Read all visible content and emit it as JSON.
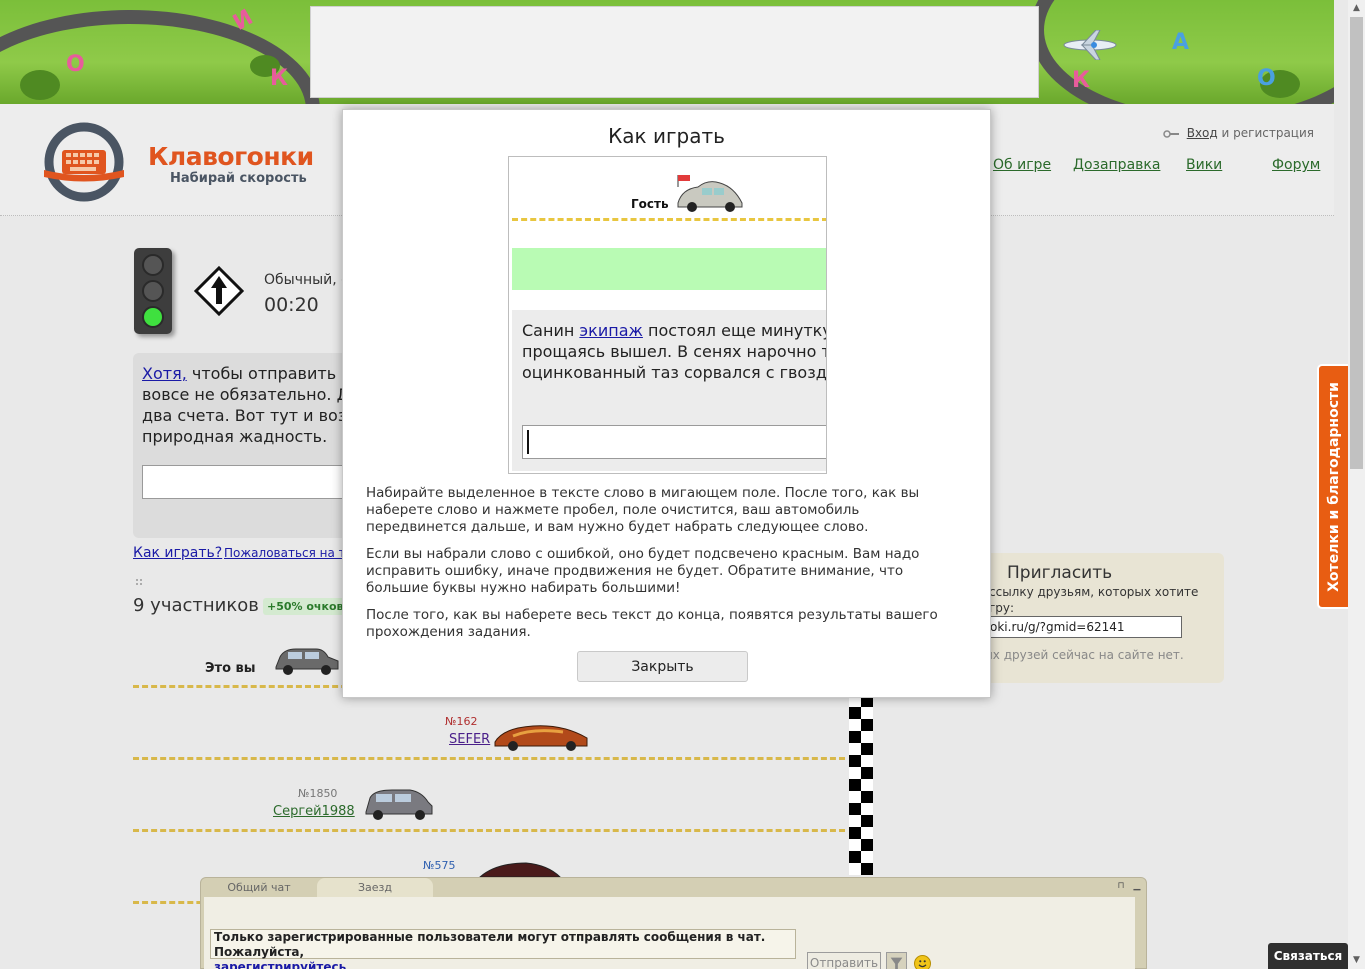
{
  "header": {
    "logo_title": "Клавогонки",
    "logo_subtitle": "Набирай скорость",
    "login_label": "Вход",
    "login_suffix": "и регистрация",
    "nav": [
      "Об игре",
      "Дозаправка",
      "Вики",
      "Форум"
    ],
    "banner_letters": [
      "О",
      "К",
      "И",
      "К",
      "А",
      "О"
    ]
  },
  "game": {
    "type_text": "Обычный, от",
    "timer": "00:20",
    "panel_link": "Хотя,",
    "panel_text_lines": [
      "чтобы отправить ме",
      "вовсе не обязательно. До",
      "два счета. Вот тут и возн",
      "природная жадность."
    ],
    "howto_link": "Как играть?",
    "complain_link": "Пожаловаться на т",
    "participants_label": "9 участников",
    "bonus_badge": "+50% очков"
  },
  "players": [
    {
      "label": "Это вы",
      "rank": "",
      "name": ""
    },
    {
      "label": "",
      "rank": "№162",
      "name": "SEFER"
    },
    {
      "label": "",
      "rank": "№1850",
      "name": "Сергей1988"
    },
    {
      "label": "",
      "rank": "№575",
      "name": ""
    }
  ],
  "invite": {
    "title": "Пригласить",
    "text": "ссылку друзьям, которых хотите",
    "text2": "гру:",
    "url": "oki.ru/g/?gmid=62141",
    "no_friends": "их друзей сейчас на сайте нет."
  },
  "side_tab": "Хотелки и благодарности",
  "chat": {
    "tabs": [
      "Общий чат",
      "Заезд"
    ],
    "notice_bold": "Только зарегистрированные пользователи могут отправлять сообщения в чат. Пожалуйста,",
    "notice_link": "зарегистрируйтесь",
    "notice_end": ".",
    "send_label": "Отправить"
  },
  "contact_button": "Связаться",
  "modal": {
    "title": "Как играть",
    "demo_guest": "Гость",
    "demo_text_before": "Санин",
    "demo_text_link": "экипаж",
    "demo_text_line1_after": "постоял еще минутку и,",
    "demo_text_line2": "прощаясь вышел. В сенях нарочно топ",
    "demo_text_line3": "оцинкованный таз сорвался с гвоздя и",
    "p1": "Набирайте выделенное в тексте слово в мигающем поле. После того, как вы наберете слово и нажмете пробел, поле очистится, ваш автомобиль передвинется дальше, и вам нужно будет набрать следующее слово.",
    "p2": "Если вы набрали слово с ошибкой, оно будет подсвечено красным. Вам надо исправить ошибку, иначе продвижения не будет. Обратите внимание, что большие буквы нужно набирать большими!",
    "p3": "После того, как вы наберете весь текст до конца, появятся результаты вашего прохождения задания.",
    "close_label": "Закрыть"
  },
  "colors": {
    "accent_orange": "#e85d12",
    "link_blue": "#1a1aa6",
    "nav_green": "#2b6a2b",
    "demo_highlight": "#b9fbb4"
  }
}
